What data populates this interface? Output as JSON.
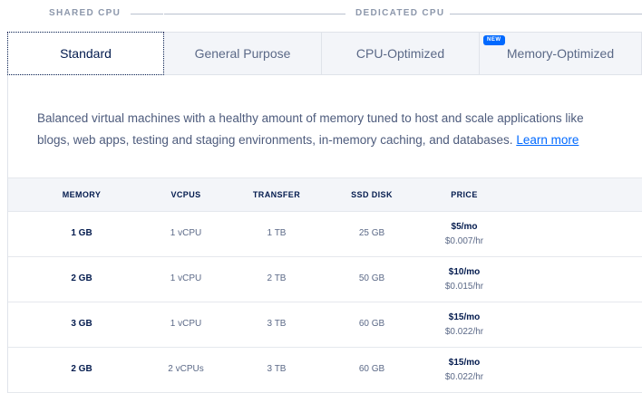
{
  "categories": {
    "shared": "SHARED CPU",
    "dedicated": "DEDICATED CPU"
  },
  "tabs": [
    {
      "label": "Standard",
      "active": true
    },
    {
      "label": "General Purpose",
      "active": false
    },
    {
      "label": "CPU-Optimized",
      "active": false
    },
    {
      "label": "Memory-Optimized",
      "active": false,
      "badge": "NEW"
    }
  ],
  "description": {
    "text": "Balanced virtual machines with a healthy amount of memory tuned to host and scale applications like blogs, web apps, testing and staging environments, in-memory caching, and databases. ",
    "link": "Learn more"
  },
  "table": {
    "headers": [
      "MEMORY",
      "VCPUS",
      "TRANSFER",
      "SSD DISK",
      "PRICE"
    ],
    "rows": [
      {
        "memory": "1 GB",
        "vcpus": "1 vCPU",
        "transfer": "1 TB",
        "disk": "25 GB",
        "price_mo": "$5/mo",
        "price_hr": "$0.007/hr"
      },
      {
        "memory": "2 GB",
        "vcpus": "1 vCPU",
        "transfer": "2 TB",
        "disk": "50 GB",
        "price_mo": "$10/mo",
        "price_hr": "$0.015/hr"
      },
      {
        "memory": "3 GB",
        "vcpus": "1 vCPU",
        "transfer": "3 TB",
        "disk": "60 GB",
        "price_mo": "$15/mo",
        "price_hr": "$0.022/hr"
      },
      {
        "memory": "2 GB",
        "vcpus": "2 vCPUs",
        "transfer": "3 TB",
        "disk": "60 GB",
        "price_mo": "$15/mo",
        "price_hr": "$0.022/hr"
      }
    ]
  },
  "colors": {
    "accent": "#0069ff",
    "text_dark": "#031b4e",
    "text_muted": "#5b6987",
    "header_bg": "#f3f5f9"
  }
}
